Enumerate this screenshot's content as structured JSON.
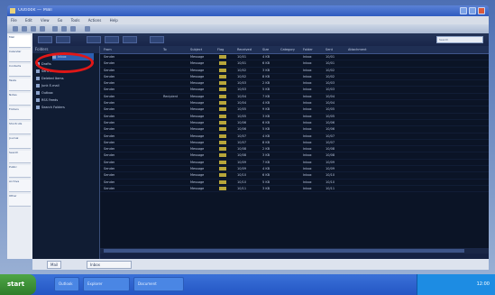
{
  "window": {
    "title": "Outlook — Mail"
  },
  "menubar": {
    "items": [
      "File",
      "Edit",
      "View",
      "Go",
      "Tools",
      "Actions",
      "Help"
    ]
  },
  "leftnav": {
    "items": [
      "Mail",
      "Calendar",
      "Contacts",
      "Tasks",
      "Notes",
      "Folders",
      "Shortcuts",
      "Journal",
      "Search",
      "Public",
      "Archive",
      "Other"
    ]
  },
  "app": {
    "search": {
      "placeholder": "Search"
    }
  },
  "tree": {
    "header": "Folders",
    "nodes": [
      {
        "label": "Inbox",
        "selected": true
      },
      {
        "label": "Drafts",
        "selected": false
      },
      {
        "label": "Sent Items",
        "selected": false
      },
      {
        "label": "Deleted Items",
        "selected": false
      },
      {
        "label": "Junk E-mail",
        "selected": false
      },
      {
        "label": "Outbox",
        "selected": false
      },
      {
        "label": "RSS Feeds",
        "selected": false
      },
      {
        "label": "Search Folders",
        "selected": false
      }
    ]
  },
  "list": {
    "columns": [
      "From",
      "To",
      "Subject",
      "Flag",
      "Received",
      "Size",
      "Category",
      "Folder",
      "Sent",
      "Attachment"
    ],
    "rows": [
      [
        "Sender",
        "",
        "Message",
        "",
        "10/01",
        "4 KB",
        "",
        "Inbox",
        "10/01",
        ""
      ],
      [
        "Sender",
        "",
        "Message",
        "",
        "10/01",
        "6 KB",
        "",
        "Inbox",
        "10/01",
        ""
      ],
      [
        "Sender",
        "",
        "Message",
        "",
        "10/02",
        "3 KB",
        "",
        "Inbox",
        "10/02",
        ""
      ],
      [
        "Sender",
        "",
        "Message",
        "",
        "10/02",
        "8 KB",
        "",
        "Inbox",
        "10/02",
        ""
      ],
      [
        "Sender",
        "",
        "Message",
        "",
        "10/03",
        "2 KB",
        "",
        "Inbox",
        "10/03",
        ""
      ],
      [
        "Sender",
        "",
        "Message",
        "",
        "10/03",
        "5 KB",
        "",
        "Inbox",
        "10/03",
        ""
      ],
      [
        "Sender",
        "Recipient",
        "Message",
        "",
        "10/04",
        "7 KB",
        "",
        "Inbox",
        "10/04",
        ""
      ],
      [
        "Sender",
        "",
        "Message",
        "",
        "10/04",
        "4 KB",
        "",
        "Inbox",
        "10/04",
        ""
      ],
      [
        "Sender",
        "",
        "Message",
        "",
        "10/05",
        "9 KB",
        "",
        "Inbox",
        "10/05",
        ""
      ],
      [
        "Sender",
        "",
        "Message",
        "",
        "10/05",
        "3 KB",
        "",
        "Inbox",
        "10/05",
        ""
      ],
      [
        "Sender",
        "",
        "Message",
        "",
        "10/06",
        "6 KB",
        "",
        "Inbox",
        "10/06",
        ""
      ],
      [
        "Sender",
        "",
        "Message",
        "",
        "10/06",
        "5 KB",
        "",
        "Inbox",
        "10/06",
        ""
      ],
      [
        "Sender",
        "",
        "Message",
        "",
        "10/07",
        "4 KB",
        "",
        "Inbox",
        "10/07",
        ""
      ],
      [
        "Sender",
        "",
        "Message",
        "",
        "10/07",
        "8 KB",
        "",
        "Inbox",
        "10/07",
        ""
      ],
      [
        "Sender",
        "",
        "Message",
        "",
        "10/08",
        "2 KB",
        "",
        "Inbox",
        "10/08",
        ""
      ],
      [
        "Sender",
        "",
        "Message",
        "",
        "10/08",
        "3 KB",
        "",
        "Inbox",
        "10/08",
        ""
      ],
      [
        "Sender",
        "",
        "Message",
        "",
        "10/09",
        "7 KB",
        "",
        "Inbox",
        "10/09",
        ""
      ],
      [
        "Sender",
        "",
        "Message",
        "",
        "10/09",
        "4 KB",
        "",
        "Inbox",
        "10/09",
        ""
      ],
      [
        "Sender",
        "",
        "Message",
        "",
        "10/10",
        "6 KB",
        "",
        "Inbox",
        "10/10",
        ""
      ],
      [
        "Sender",
        "",
        "Message",
        "",
        "10/10",
        "5 KB",
        "",
        "Inbox",
        "10/10",
        ""
      ],
      [
        "Sender",
        "",
        "Message",
        "",
        "10/11",
        "3 KB",
        "",
        "Inbox",
        "10/11",
        ""
      ]
    ]
  },
  "tabs": [
    {
      "label": "Mail"
    },
    {
      "label": "Inbox"
    }
  ],
  "taskbar": {
    "start_label": "start",
    "tasks": [
      "Outlook",
      "Explorer",
      "Document"
    ],
    "clock": "12:00"
  },
  "colors": {
    "highlight": "#e01717",
    "list_bg": "#0b1426",
    "flag": "#b8a63a"
  }
}
